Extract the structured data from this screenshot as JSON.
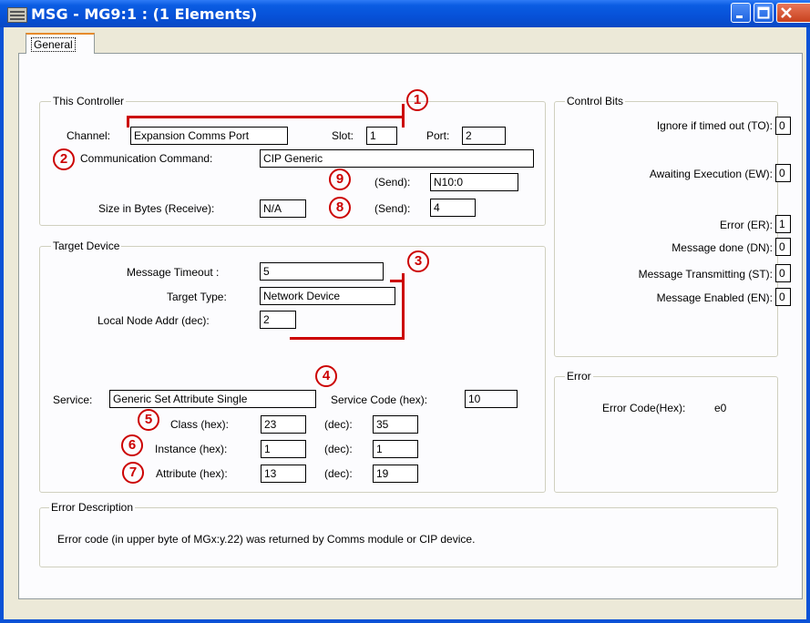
{
  "window": {
    "title": "MSG - MG9:1 : (1 Elements)"
  },
  "tabs": [
    {
      "label": "General"
    }
  ],
  "this_controller": {
    "title": "This Controller",
    "channel_label": "Channel:",
    "channel_value": "Expansion Comms Port",
    "slot_label": "Slot:",
    "slot_value": "1",
    "port_label": "Port:",
    "port_value": "2",
    "command_label": "Communication Command:",
    "command_value": "CIP Generic",
    "send_label": "(Send):",
    "send_value": "N10:0",
    "size_label": "Size in Bytes (Receive):",
    "size_receive_value": "N/A",
    "size_send_label": "(Send):",
    "size_send_value": "4"
  },
  "target_device": {
    "title": "Target Device",
    "timeout_label": "Message Timeout :",
    "timeout_value": "5",
    "target_type_label": "Target Type:",
    "target_type_value": "Network Device",
    "node_label": "Local Node Addr (dec):",
    "node_value": "2",
    "service_label": "Service:",
    "service_value": "Generic Set Attribute Single",
    "service_code_label": "Service Code (hex):",
    "service_code_value": "10",
    "class_label": "Class (hex):",
    "class_hex": "23",
    "class_dec_label": "(dec):",
    "class_dec": "35",
    "instance_label": "Instance (hex):",
    "instance_hex": "1",
    "instance_dec_label": "(dec):",
    "instance_dec": "1",
    "attribute_label": "Attribute (hex):",
    "attribute_hex": "13",
    "attribute_dec_label": "(dec):",
    "attribute_dec": "19"
  },
  "control_bits": {
    "title": "Control Bits",
    "items": [
      {
        "label": "Ignore if timed out (TO):",
        "value": "0"
      },
      {
        "label": "Awaiting Execution (EW):",
        "value": "0"
      },
      {
        "label": "Error (ER):",
        "value": "1"
      },
      {
        "label": "Message done (DN):",
        "value": "0"
      },
      {
        "label": "Message Transmitting (ST):",
        "value": "0"
      },
      {
        "label": "Message Enabled (EN):",
        "value": "0"
      }
    ]
  },
  "error": {
    "title": "Error",
    "code_label": "Error Code(Hex):",
    "code_value": "e0"
  },
  "error_description": {
    "title": "Error Description",
    "text": "Error code (in upper byte of MGx:y.22) was returned by Comms module or CIP device."
  },
  "callouts": [
    "1",
    "2",
    "3",
    "4",
    "5",
    "6",
    "7",
    "8",
    "9"
  ],
  "colors": {
    "callout": "#cc0000",
    "titlebar": "#0a5ce2",
    "face": "#ece9d8"
  }
}
